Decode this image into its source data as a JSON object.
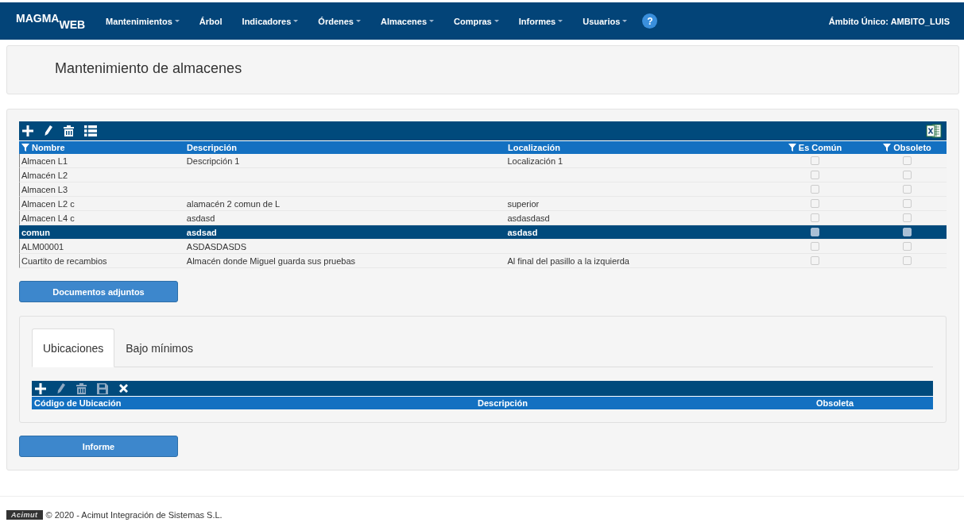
{
  "navbar": {
    "logo_main": "MAGMA",
    "logo_sub": "WEB",
    "menu": [
      {
        "label": "Mantenimientos",
        "dropdown": true
      },
      {
        "label": "Árbol",
        "dropdown": false
      },
      {
        "label": "Indicadores",
        "dropdown": true
      },
      {
        "label": "Órdenes",
        "dropdown": true
      },
      {
        "label": "Almacenes",
        "dropdown": true
      },
      {
        "label": "Compras",
        "dropdown": true
      },
      {
        "label": "Informes",
        "dropdown": true
      },
      {
        "label": "Usuarios",
        "dropdown": true
      }
    ],
    "help": "?",
    "scope": "Ámbito Único: AMBITO_LUIS"
  },
  "page_title": "Mantenimiento de almacenes",
  "grid": {
    "toolbar": [
      {
        "kind": "add",
        "disabled": false
      },
      {
        "kind": "edit",
        "disabled": false
      },
      {
        "kind": "delete",
        "disabled": false
      },
      {
        "kind": "list",
        "disabled": false
      }
    ],
    "columns": [
      {
        "label": "Nombre",
        "filter": true
      },
      {
        "label": "Descripción",
        "filter": false
      },
      {
        "label": "Localización",
        "filter": false
      },
      {
        "label": "Es Común",
        "filter": true
      },
      {
        "label": "Obsoleto",
        "filter": true
      }
    ],
    "rows": [
      {
        "nombre": "Almacen L1",
        "descripcion": "Descripción 1",
        "localizacion": "Localización 1",
        "es_comun": false,
        "obsoleto": false,
        "selected": false
      },
      {
        "nombre": "Almacén L2",
        "descripcion": "",
        "localizacion": "",
        "es_comun": false,
        "obsoleto": false,
        "selected": false
      },
      {
        "nombre": "Almacen L3",
        "descripcion": "",
        "localizacion": "",
        "es_comun": false,
        "obsoleto": false,
        "selected": false
      },
      {
        "nombre": "Almacen L2 c",
        "descripcion": "alamacén 2 comun de L",
        "localizacion": "superior",
        "es_comun": false,
        "obsoleto": false,
        "selected": false
      },
      {
        "nombre": "Almacen L4 c",
        "descripcion": "asdasd",
        "localizacion": "asdasdasd",
        "es_comun": false,
        "obsoleto": false,
        "selected": false
      },
      {
        "nombre": "comun",
        "descripcion": "asdsad",
        "localizacion": "asdasd",
        "es_comun": false,
        "obsoleto": false,
        "selected": true
      },
      {
        "nombre": "ALM00001",
        "descripcion": "ASDASDASDS",
        "localizacion": "",
        "es_comun": false,
        "obsoleto": false,
        "selected": false
      },
      {
        "nombre": "Cuartito de recambios",
        "descripcion": "Almacén donde Miguel guarda sus pruebas",
        "localizacion": "Al final del pasillo a la izquierda",
        "es_comun": false,
        "obsoleto": false,
        "selected": false
      }
    ]
  },
  "attachments_button": "Documentos adjuntos",
  "tabs": [
    {
      "label": "Ubicaciones",
      "selected": true
    },
    {
      "label": "Bajo mínimos",
      "selected": false
    }
  ],
  "locations_grid": {
    "toolbar": [
      {
        "kind": "add",
        "disabled": false
      },
      {
        "kind": "edit",
        "disabled": true
      },
      {
        "kind": "delete",
        "disabled": true
      },
      {
        "kind": "save",
        "disabled": true
      },
      {
        "kind": "cancel",
        "disabled": false
      }
    ],
    "columns": [
      "Código de Ubicación",
      "Descripción",
      "Obsoleta"
    ]
  },
  "report_button": "Informe",
  "footer": {
    "logo": "Acimut",
    "text": "© 2020 - Acimut Integración de Sistemas S.L."
  }
}
